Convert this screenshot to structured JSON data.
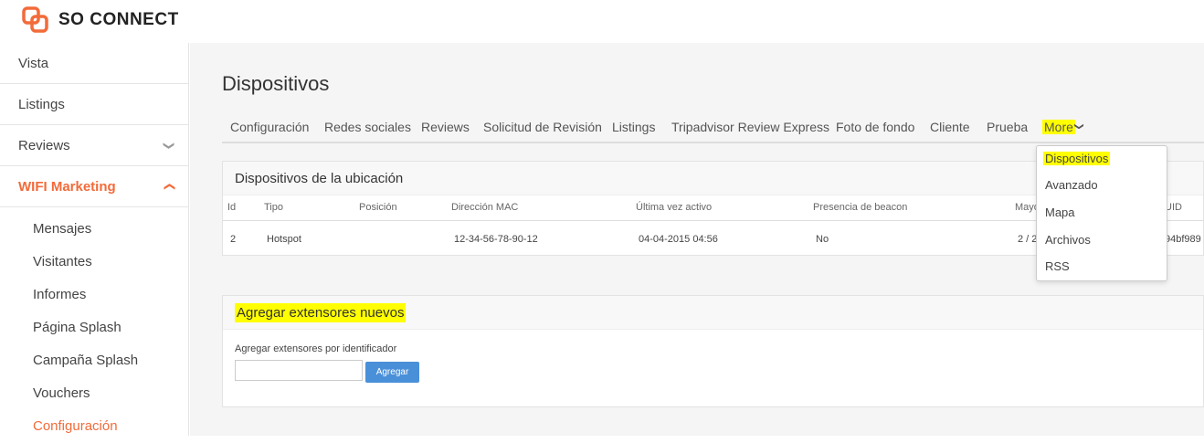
{
  "brand": {
    "name": "SO CONNECT",
    "accent": "#f26b3a",
    "highlight": "#ffff00",
    "button": "#4a90d9"
  },
  "sidebar": {
    "items": [
      {
        "label": "Vista"
      },
      {
        "label": "Listings"
      },
      {
        "label": "Reviews",
        "icon": "chevron-down-icon"
      },
      {
        "label": "WIFI Marketing",
        "icon": "chevron-up-icon"
      }
    ],
    "subitems": [
      {
        "label": "Mensajes"
      },
      {
        "label": "Visitantes"
      },
      {
        "label": "Informes"
      },
      {
        "label": "Página Splash"
      },
      {
        "label": "Campaña Splash"
      },
      {
        "label": "Vouchers"
      },
      {
        "label": "Configuración"
      }
    ]
  },
  "page": {
    "title": "Dispositivos"
  },
  "tabs": [
    {
      "label": "Configuración"
    },
    {
      "label": "Redes sociales"
    },
    {
      "label": "Reviews"
    },
    {
      "label": "Solicitud de Revisión"
    },
    {
      "label": "Listings"
    },
    {
      "label": "Tripadvisor Review Express"
    },
    {
      "label": "Foto de fondo"
    },
    {
      "label": "Cliente"
    },
    {
      "label": "Prueba"
    },
    {
      "label": "More",
      "icon": "chevron-down-icon"
    }
  ],
  "more_menu": [
    {
      "label": "Dispositivos"
    },
    {
      "label": "Avanzado"
    },
    {
      "label": "Mapa"
    },
    {
      "label": "Archivos"
    },
    {
      "label": "RSS"
    }
  ],
  "devices_panel": {
    "title": "Dispositivos de la ubicación",
    "columns": [
      "Id",
      "Tipo",
      "Posición",
      "Dirección MAC",
      "Última vez activo",
      "Presencia de beacon",
      "Mayo",
      "UID"
    ],
    "row": {
      "id": "2",
      "tipo": "Hotspot",
      "posicion": "",
      "mac": "12-34-56-78-90-12",
      "ultima": "04-04-2015 04:56",
      "beacon": "No",
      "mayo": "2 / 2",
      "uid": "94bf989"
    }
  },
  "extenders_panel": {
    "title": "Agregar extensores nuevos",
    "label": "Agregar extensores por identificador",
    "input_value": "",
    "button": "Agregar"
  }
}
